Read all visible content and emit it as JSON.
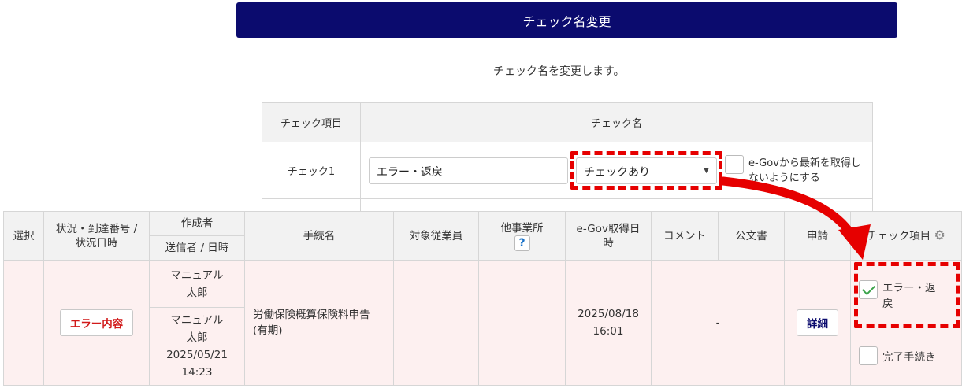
{
  "header": {
    "title": "チェック名変更"
  },
  "description": "チェック名を変更します。",
  "rename_table": {
    "col_item": "チェック項目",
    "col_name": "チェック名",
    "row": {
      "item": "チェック1",
      "name_value": "エラー・返戻",
      "select_value": "チェックあり",
      "egov_label": "e-Govから最新を取得しないようにする"
    }
  },
  "main_table": {
    "headers": {
      "select": "選択",
      "status_line1": "状況・到達番号 /",
      "status_line2": "状況日時",
      "creator": "作成者",
      "sender": "送信者 / 日時",
      "procedure": "手続名",
      "employee": "対象従業員",
      "other_office": "他事業所",
      "help": "?",
      "egov_date_line1": "e-Gov取得日",
      "egov_date_line2": "時",
      "comment": "コメント",
      "official_doc": "公文書",
      "application": "申請",
      "check_item": "チェック項目"
    },
    "row": {
      "error_button": "エラー内容",
      "creator_line1": "マニュアル",
      "creator_line2": "太郎",
      "sender_line1": "マニュアル",
      "sender_line2": "太郎",
      "sender_date": "2025/05/21",
      "sender_time": "14:23",
      "procedure_line1": "労働保険概算保険料申告",
      "procedure_line2": "(有期)",
      "egov_date": "2025/08/18",
      "egov_time": "16:01",
      "comment": "-",
      "detail_button": "詳細",
      "check1_label_line1": "エラー・返",
      "check1_label_line2": "戻",
      "check2_label": "完了手続き"
    }
  },
  "colors": {
    "title_bg": "#0b0b6e",
    "annotation": "#e60000",
    "row_bg": "#fdf0f0"
  },
  "icons": [
    "gear-icon",
    "dropdown-caret-icon",
    "checkmark-icon",
    "help-icon"
  ]
}
